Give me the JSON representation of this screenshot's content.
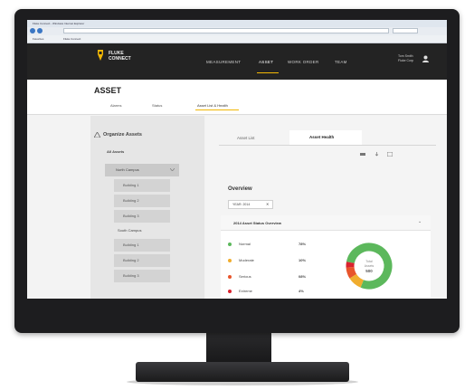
{
  "browser": {
    "title": "Fluke Connect - Windows Internet Explorer",
    "favorites_label": "Favorites",
    "favorite_link": "Fluke Connect"
  },
  "app": {
    "brand_line1": "FLUKE",
    "brand_line2": "CONNECT",
    "nav": [
      "MEASUREMENT",
      "ASSET",
      "WORK ORDER",
      "TEAM"
    ],
    "user_line1": "Tom Smith",
    "user_line2": "Fluke Corp"
  },
  "asset_header": {
    "title": "ASSET",
    "subnav": [
      "Alarms",
      "Status",
      "Asset List & Health"
    ]
  },
  "sidebar": {
    "title": "Organize Assets",
    "all_assets": "All Assets",
    "items": [
      {
        "label": "North Campus"
      },
      {
        "label": "Building 1"
      },
      {
        "label": "Building 2"
      },
      {
        "label": "Building 3"
      },
      {
        "label": "South Campus"
      },
      {
        "label": "Building 1"
      },
      {
        "label": "Building 2"
      },
      {
        "label": "Building 3"
      }
    ]
  },
  "main": {
    "tabs": [
      "Asset List",
      "Asset Health"
    ],
    "overview_title": "Overview",
    "year_label": "YEAR: 2014",
    "panel_title": "2014 Asset Status Overview",
    "legend": [
      {
        "label": "Normal",
        "value": "78%",
        "color": "#5cb85c"
      },
      {
        "label": "Moderate",
        "value": "10%",
        "color": "#f0ad2e"
      },
      {
        "label": "Serious",
        "value": "08%",
        "color": "#e8552b"
      },
      {
        "label": "Extreme",
        "value": "4%",
        "color": "#d9232e"
      }
    ],
    "donut_center": [
      "Total",
      "Assets",
      "500"
    ]
  }
}
